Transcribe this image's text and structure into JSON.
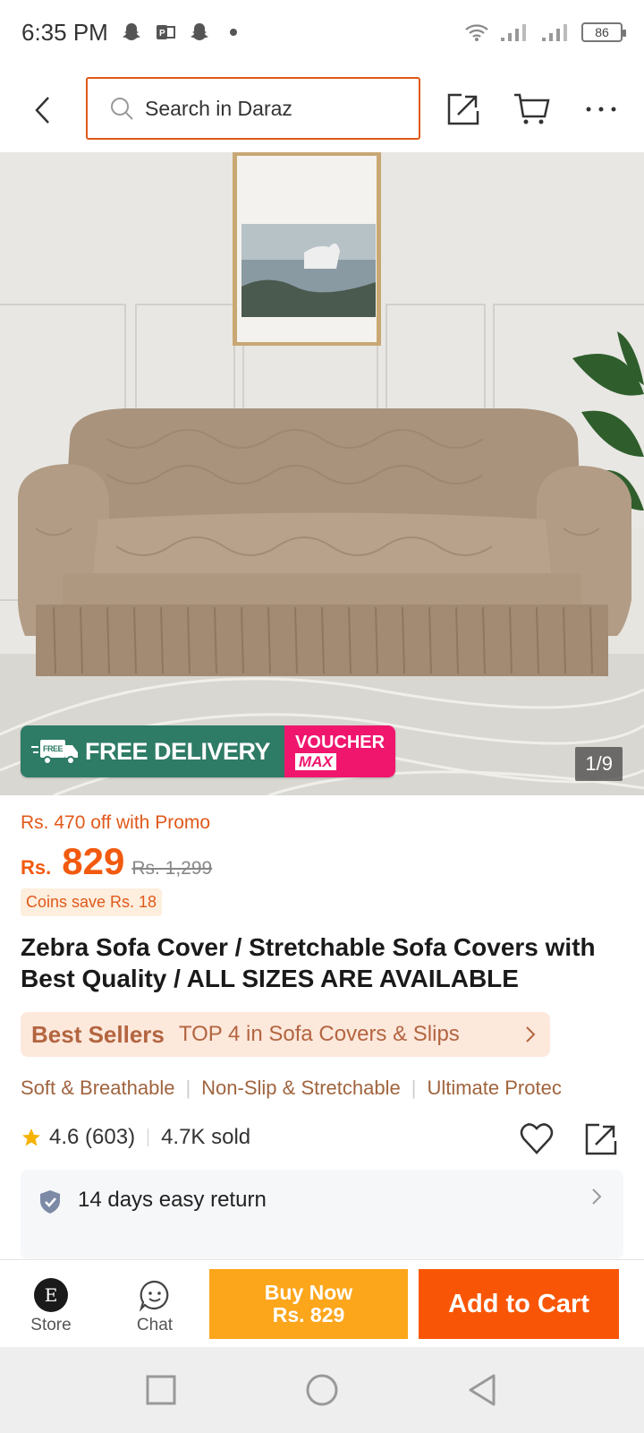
{
  "status_bar": {
    "time": "6:35 PM",
    "battery": "86",
    "left_icons": [
      "snapchat-icon",
      "powerpoint-icon",
      "snapchat-icon",
      "dot-icon"
    ],
    "right_icons": [
      "wifi-icon",
      "signal-icon",
      "signal-icon",
      "battery-icon"
    ]
  },
  "header": {
    "search_placeholder": "Search in Daraz",
    "icons": [
      "back-arrow-icon",
      "search-icon",
      "share-icon",
      "cart-icon",
      "more-icon"
    ]
  },
  "gallery": {
    "counter": "1/9",
    "promo_free": "FREE DELIVERY",
    "promo_free_badge": "FREE",
    "promo_voucher_top": "VOUCHER",
    "promo_voucher_bottom": "MAX"
  },
  "pricing": {
    "promo": "Rs. 470 off with Promo",
    "currency": "Rs.",
    "price": "829",
    "original_price": "Rs. 1,299",
    "coins": "Coins save Rs. 18"
  },
  "product": {
    "title": "Zebra Sofa Cover / Stretchable Sofa Covers with Best Quality / ALL SIZES ARE AVAILABLE",
    "best_sellers_label": "Best Sellers",
    "best_sellers_text": "TOP 4 in Sofa Covers & Slips",
    "features": [
      "Soft & Breathable",
      "Non-Slip & Stretchable",
      "Ultimate Protec"
    ],
    "rating": "4.6 (603)",
    "sold": "4.7K sold",
    "return_policy": "14 days easy return"
  },
  "action_bar": {
    "store_label": "Store",
    "chat_label": "Chat",
    "buy_now_line1": "Buy Now",
    "buy_now_line2": "Rs. 829",
    "add_to_cart": "Add to Cart"
  },
  "colors": {
    "accent": "#f85606",
    "buy_now": "#fca61c",
    "free_delivery": "#2e7b66",
    "voucher": "#f0166e",
    "search_border": "#e0591a"
  }
}
